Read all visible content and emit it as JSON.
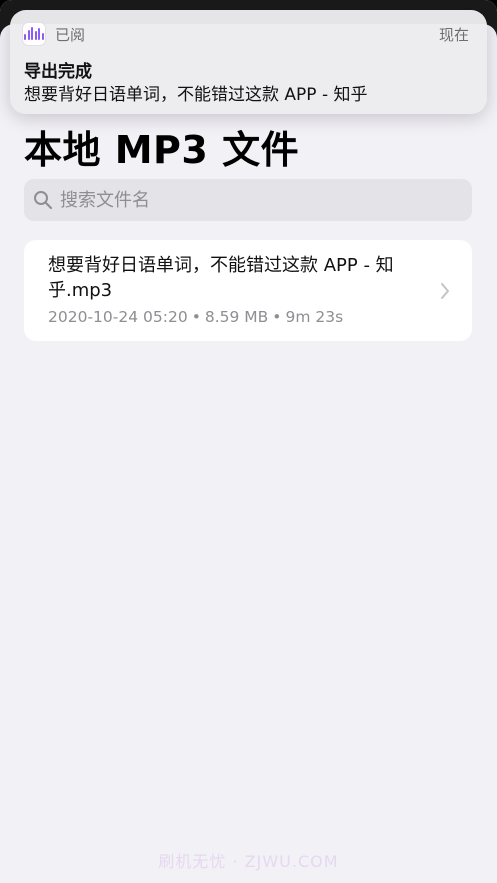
{
  "notification": {
    "app_name": "已阅",
    "time": "现在",
    "title": "导出完成",
    "body": "想要背好日语单词，不能错过这款 APP - 知乎"
  },
  "page": {
    "title": "本地 MP3 文件"
  },
  "search": {
    "placeholder": "搜索文件名",
    "value": ""
  },
  "files": [
    {
      "name": "想要背好日语单词，不能错过这款 APP - 知乎.mp3",
      "date": "2020-10-24 05:20",
      "size": "8.59 MB",
      "duration": "9m 23s"
    }
  ],
  "meta_separator": "•",
  "watermark": "刷机无忧 · ZJWU.COM",
  "colors": {
    "background": "#f2f1f6",
    "accent_icon": "#8b5cf6",
    "secondary_text": "#8e8e93"
  }
}
